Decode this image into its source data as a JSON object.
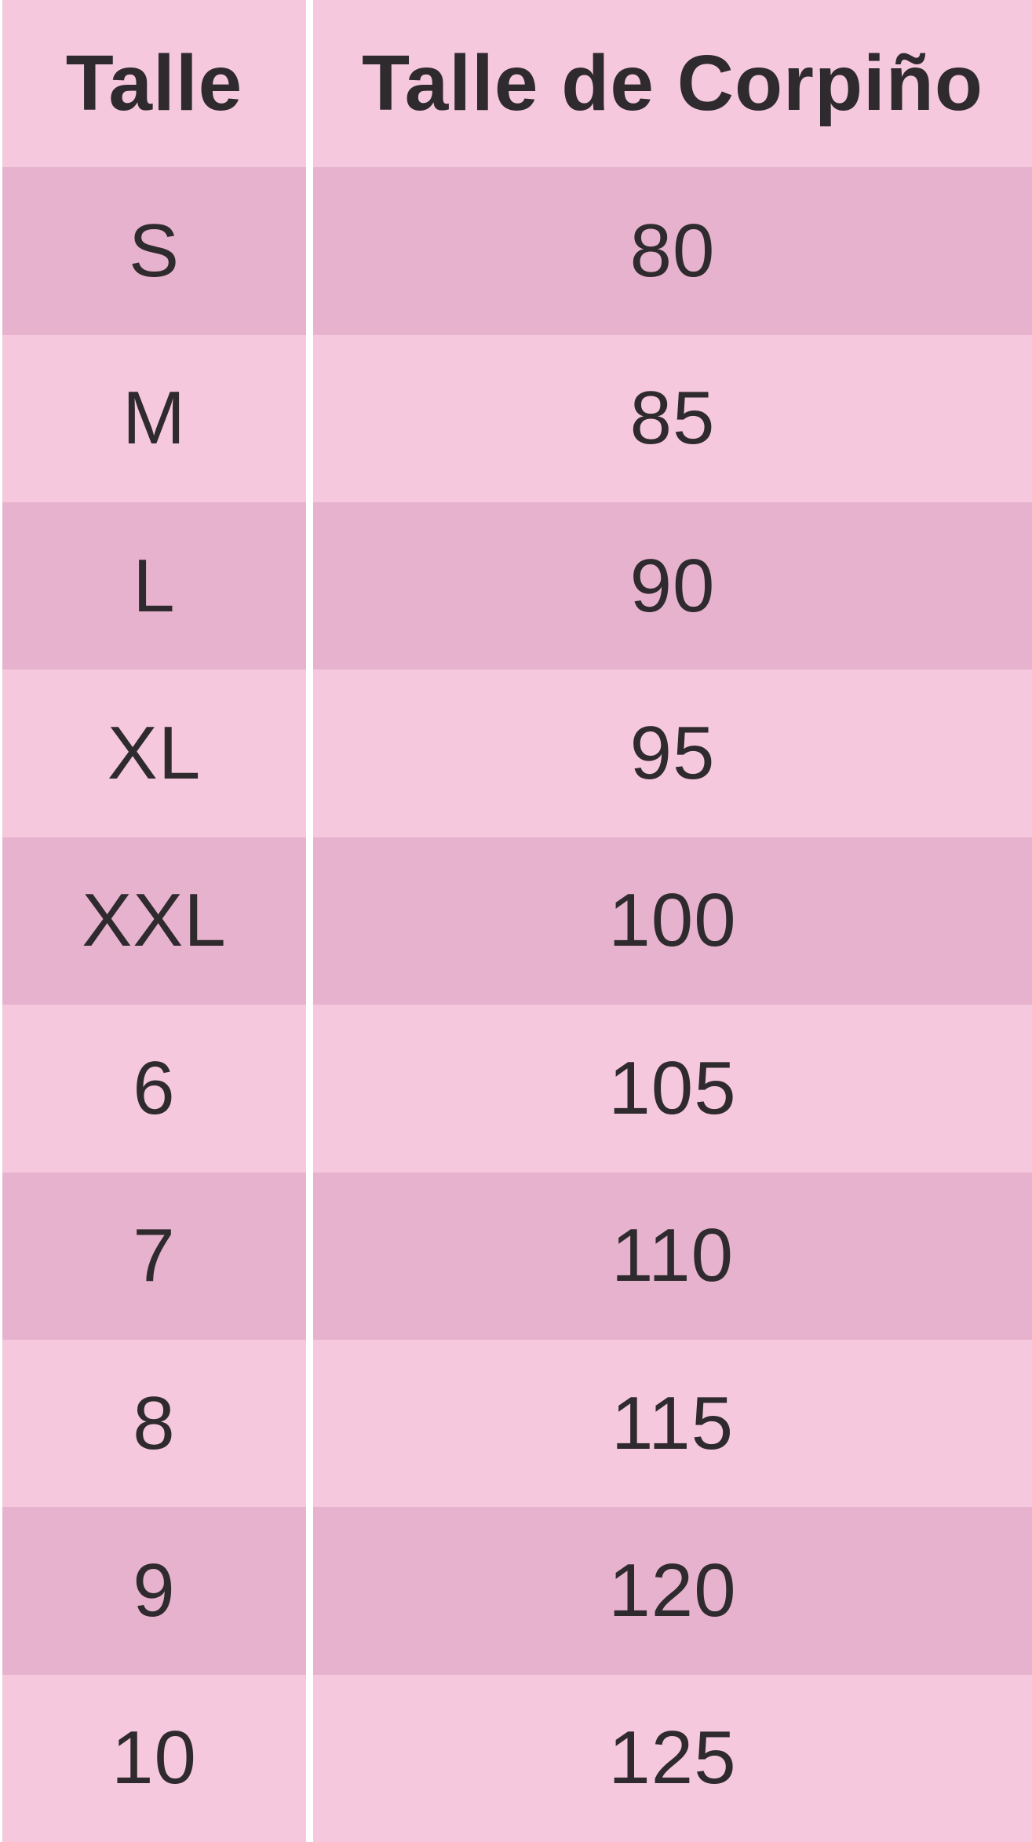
{
  "table": {
    "headers": {
      "size": "Talle",
      "bust": "Talle de Corpiño"
    },
    "rows": [
      {
        "size": "S",
        "bust": "80"
      },
      {
        "size": "M",
        "bust": "85"
      },
      {
        "size": "L",
        "bust": "90"
      },
      {
        "size": "XL",
        "bust": "95"
      },
      {
        "size": "XXL",
        "bust": "100"
      },
      {
        "size": "6",
        "bust": "105"
      },
      {
        "size": "7",
        "bust": "110"
      },
      {
        "size": "8",
        "bust": "115"
      },
      {
        "size": "9",
        "bust": "120"
      },
      {
        "size": "10",
        "bust": "125"
      }
    ]
  },
  "colors": {
    "light_row": "#f6c8dd",
    "dark_row": "#e6b2cd",
    "text": "#2e2a2e",
    "divider": "#ffffff"
  }
}
